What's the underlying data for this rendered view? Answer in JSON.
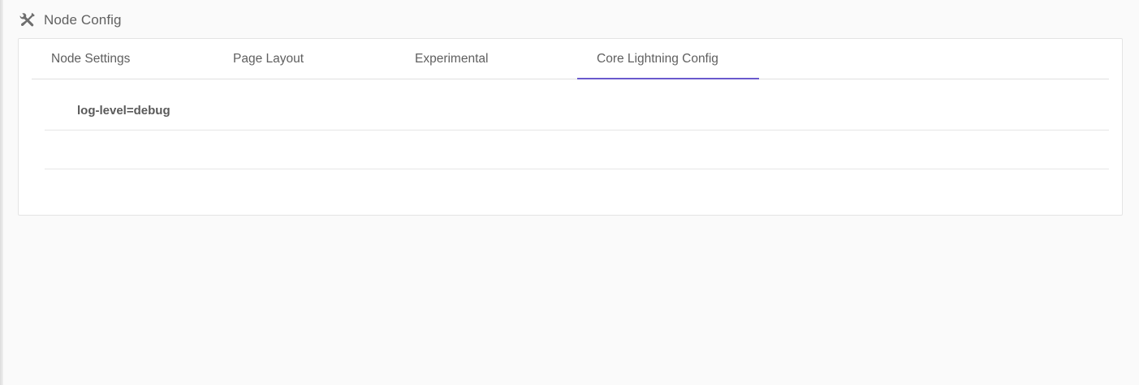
{
  "header": {
    "title": "Node Config",
    "icon": "tools-icon"
  },
  "tabs": [
    {
      "label": "Node Settings",
      "active": false
    },
    {
      "label": "Page Layout",
      "active": false
    },
    {
      "label": "Experimental",
      "active": false
    },
    {
      "label": "Core Lightning Config",
      "active": true
    }
  ],
  "config": {
    "lines": [
      "log-level=debug",
      ""
    ]
  },
  "colors": {
    "accent": "#6a5acd",
    "background": "#fafafa",
    "card": "#ffffff"
  }
}
